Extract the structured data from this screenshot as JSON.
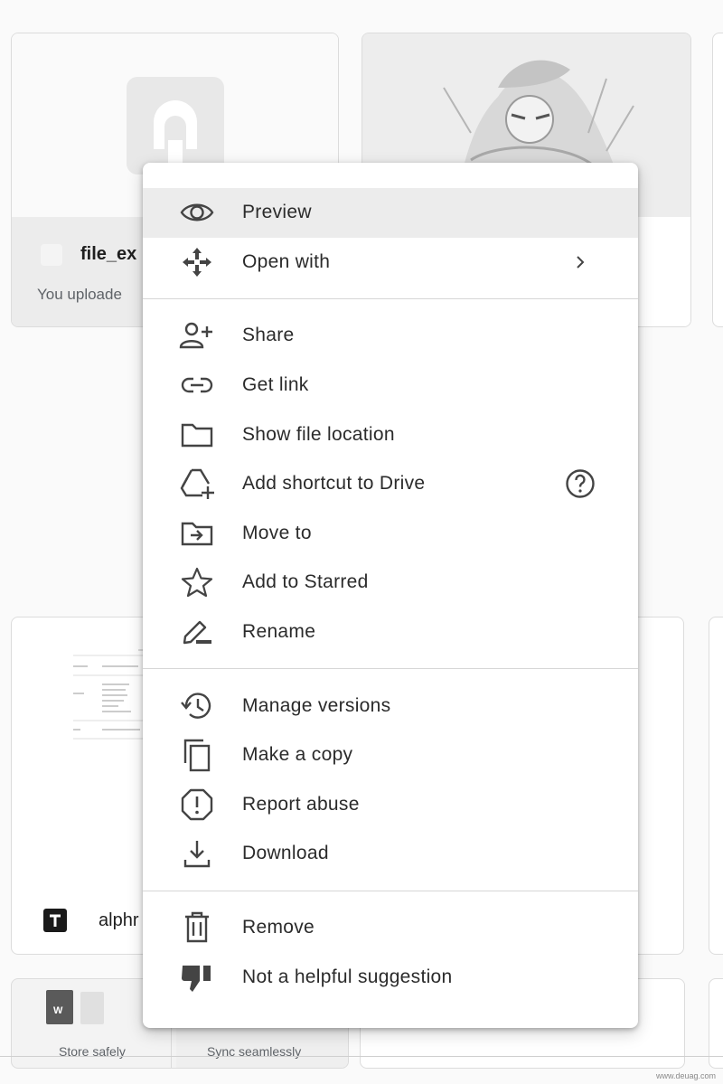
{
  "background_cards": {
    "top_left": {
      "file_name": "file_ex",
      "subtitle": "You uploade"
    },
    "middle_left": {
      "file_name": "alphr"
    },
    "bottom_row": {
      "store_label": "Store safely",
      "sync_label": "Sync seamlessly"
    }
  },
  "context_menu": {
    "items": [
      {
        "label": "Preview",
        "icon": "eye-icon"
      },
      {
        "label": "Open with",
        "icon": "move-arrows-icon"
      },
      {
        "label": "Share",
        "icon": "person-add-icon"
      },
      {
        "label": "Get link",
        "icon": "link-icon"
      },
      {
        "label": "Show file location",
        "icon": "folder-icon"
      },
      {
        "label": "Add shortcut to Drive",
        "icon": "drive-shortcut-icon"
      },
      {
        "label": "Move to",
        "icon": "folder-move-icon"
      },
      {
        "label": "Add to Starred",
        "icon": "star-icon"
      },
      {
        "label": "Rename",
        "icon": "pencil-icon"
      },
      {
        "label": "Manage versions",
        "icon": "history-icon"
      },
      {
        "label": "Make a copy",
        "icon": "copy-icon"
      },
      {
        "label": "Report abuse",
        "icon": "report-icon"
      },
      {
        "label": "Download",
        "icon": "download-icon"
      },
      {
        "label": "Remove",
        "icon": "trash-icon"
      },
      {
        "label": "Not a helpful suggestion",
        "icon": "thumbs-down-icon"
      }
    ]
  },
  "watermark": "www.deuag.com"
}
